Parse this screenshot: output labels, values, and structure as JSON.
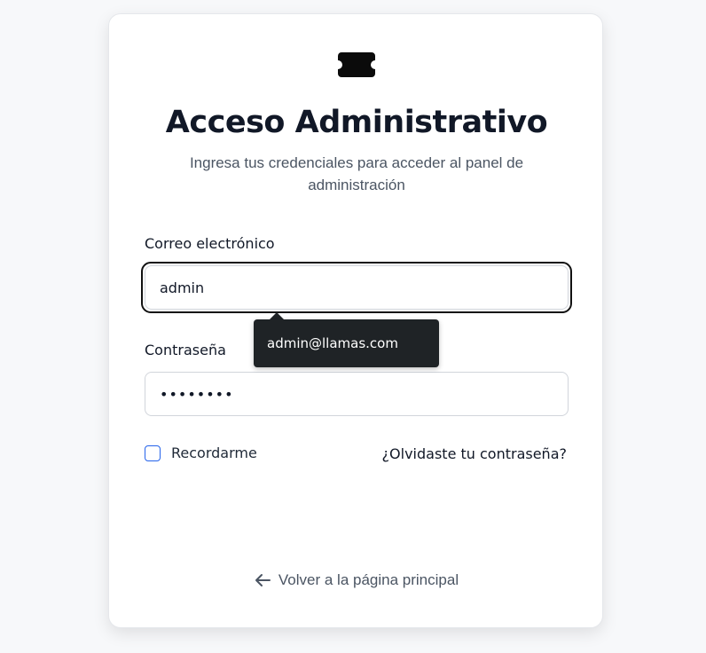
{
  "login": {
    "logo_icon": "ticket-icon",
    "title": "Acceso Administrativo",
    "subtitle": "Ingresa tus credenciales para acceder al panel de administración",
    "email_label": "Correo electrónico",
    "email_value": "admin",
    "email_suggestion": "admin@llamas.com",
    "password_label": "Contraseña",
    "password_value": "••••••••",
    "remember_label": "Recordarme",
    "remember_checked": false,
    "forgot_label": "¿Olvidaste tu contraseña?",
    "back_icon": "arrow-left-icon",
    "back_label": "Volver a la página principal"
  },
  "colors": {
    "background": "#f7f8fa",
    "card": "#ffffff",
    "text": "#111827",
    "muted": "#4b5563",
    "tooltip_bg": "#1f2326",
    "checkbox_border": "#2563eb"
  }
}
